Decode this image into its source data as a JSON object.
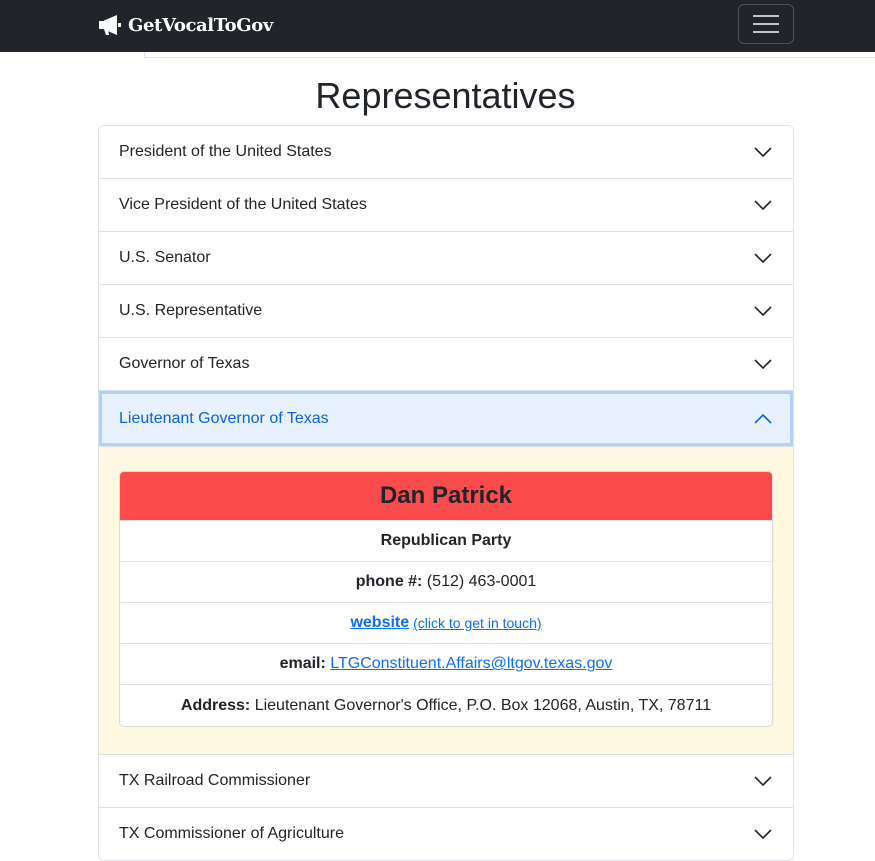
{
  "navbar": {
    "brand": "GetVocalToGov",
    "brand_icon": "megaphone-icon",
    "menu_icon": "hamburger-menu-icon"
  },
  "page": {
    "title": "Representatives"
  },
  "accordion": {
    "items": [
      {
        "label": "President of the United States"
      },
      {
        "label": "Vice President of the United States"
      },
      {
        "label": "U.S. Senator"
      },
      {
        "label": "U.S. Representative"
      },
      {
        "label": "Governor of Texas"
      },
      {
        "label": "Lieutenant Governor of Texas"
      },
      {
        "label": "TX Railroad Commissioner"
      },
      {
        "label": "TX Commissioner of Agriculture"
      }
    ],
    "open_index": 5
  },
  "representative": {
    "name": "Dan Patrick",
    "party": "Republican Party",
    "phone_label": "phone #:",
    "phone": "(512) 463-0001",
    "website_label": "website",
    "website_hint": "(click to get in touch)",
    "email_label": "email:",
    "email": "LTGConstituent.Affairs@ltgov.texas.gov",
    "address_label": "Address:",
    "address": "Lieutenant Governor's Office, P.O. Box 12068, Austin, TX, 78711"
  },
  "colors": {
    "navbar_bg": "#212529",
    "accent": "#0d6efd",
    "open_header_bg": "#e7f1ff",
    "body_bg": "#fff8e1",
    "party_color": "#fa4c4c"
  }
}
